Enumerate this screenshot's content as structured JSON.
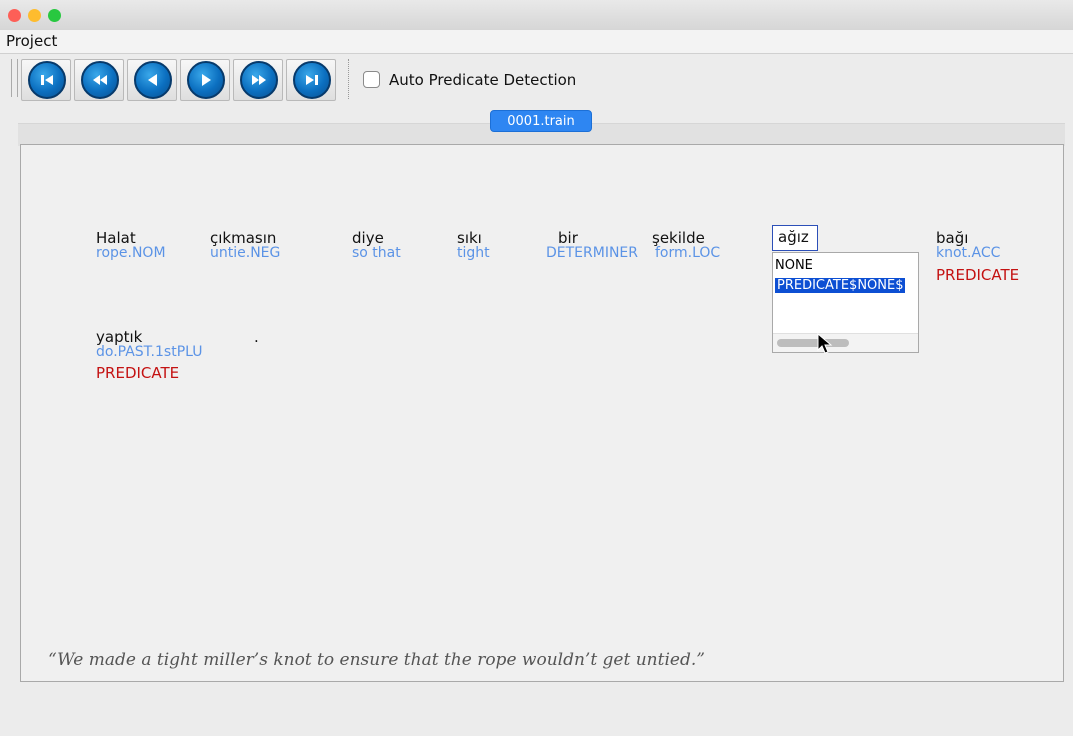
{
  "window": {
    "traffic_lights": {
      "close": "#fd5f57",
      "minimize": "#febc2e",
      "zoom": "#28c840"
    }
  },
  "menu": {
    "project_label": "Project"
  },
  "toolbar": {
    "buttons": [
      {
        "icon": "skip-to-first-icon"
      },
      {
        "icon": "fast-backward-icon"
      },
      {
        "icon": "previous-icon"
      },
      {
        "icon": "next-icon"
      },
      {
        "icon": "fast-forward-icon"
      },
      {
        "icon": "skip-to-last-icon"
      }
    ],
    "auto_predicate_label": "Auto Predicate Detection",
    "auto_predicate_checked": false
  },
  "tab": {
    "label": "0001.train"
  },
  "sentence": {
    "words": [
      {
        "text": "Halat",
        "gloss": "rope.NOM",
        "tag": ""
      },
      {
        "text": "çıkmasın",
        "gloss": "untie.NEG",
        "tag": ""
      },
      {
        "text": "diye",
        "gloss": "so that",
        "tag": ""
      },
      {
        "text": "sıkı",
        "gloss": "tight",
        "tag": ""
      },
      {
        "text": "bir",
        "gloss": "DETERMINER",
        "tag": ""
      },
      {
        "text": "şekilde",
        "gloss": "form.LOC",
        "tag": ""
      },
      {
        "text": "ağız",
        "gloss": "",
        "tag": ""
      },
      {
        "text": "bağı",
        "gloss": "knot.ACC",
        "tag": "PREDICATE"
      },
      {
        "text": "yaptık",
        "gloss": "do.PAST.1stPLU",
        "tag": "PREDICATE"
      },
      {
        "text": ".",
        "gloss": "",
        "tag": ""
      }
    ],
    "translation": "“We made a tight miller’s knot to ensure that the rope wouldn’t get untied.”"
  },
  "dropdown": {
    "options": [
      "NONE",
      "PREDICATE$NONE$"
    ],
    "selected_index": 1
  },
  "colors": {
    "gloss": "#5b93e6",
    "predicate": "#c41212",
    "accent": "#2e86f2",
    "selection": "#0d4fd3"
  }
}
